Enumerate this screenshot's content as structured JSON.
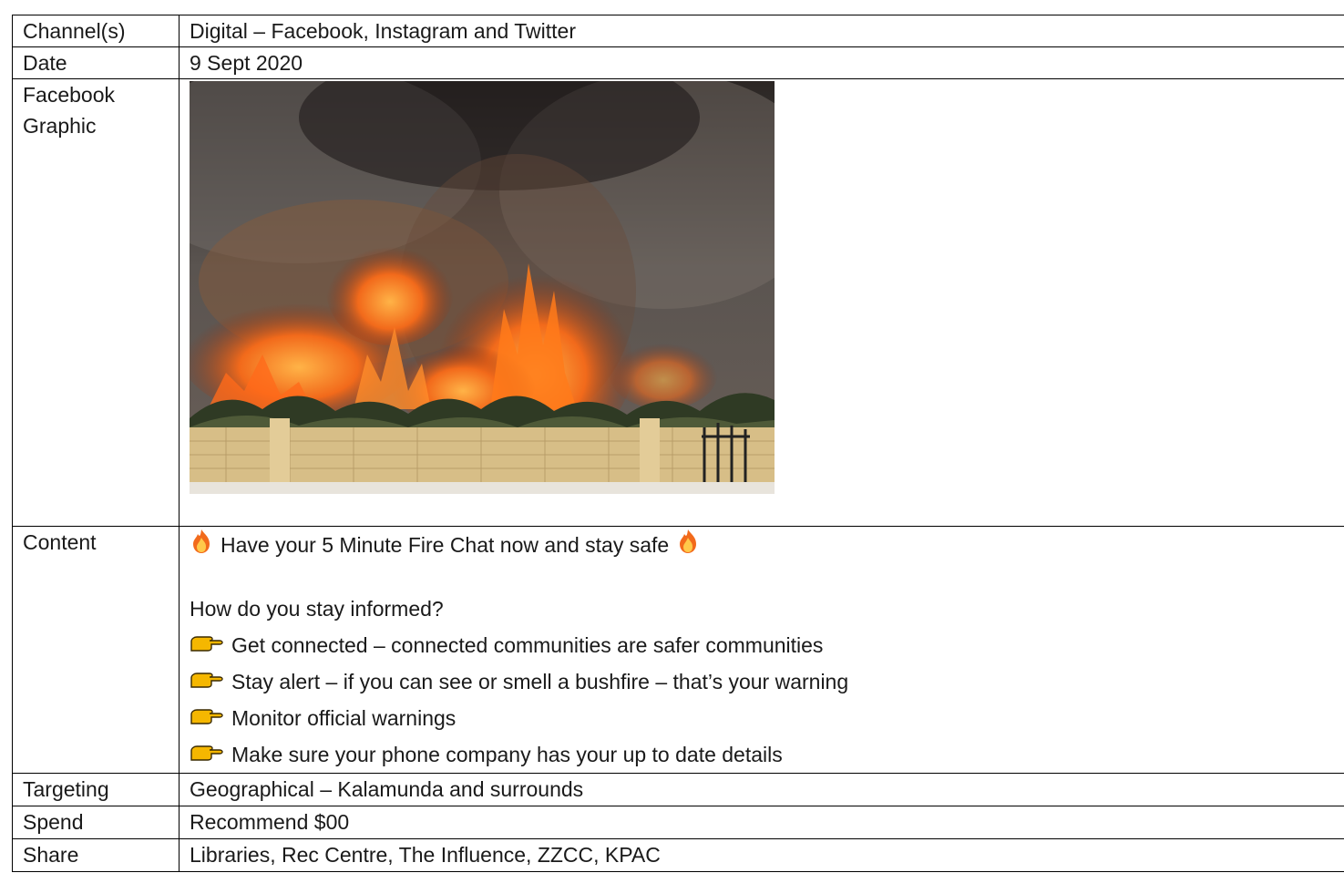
{
  "rows": {
    "channel": {
      "label": "Channel(s)",
      "value": "Digital – Facebook, Instagram and Twitter"
    },
    "date": {
      "label": "Date",
      "value": "9 Sept 2020"
    },
    "graphic": {
      "label_line1": "Facebook",
      "label_line2": "Graphic"
    },
    "content": {
      "label": "Content",
      "headline": "Have your 5 Minute Fire Chat now and stay safe",
      "question": "How do you stay informed?",
      "points": [
        "Get connected – connected communities are safer communities",
        "Stay alert – if you can see or smell a bushfire – that’s your warning",
        "Monitor official warnings",
        "Make sure your phone company has your up to date details"
      ]
    },
    "targeting": {
      "label": "Targeting",
      "value": "Geographical – Kalamunda and surrounds"
    },
    "spend": {
      "label": "Spend",
      "value": "Recommend $00"
    },
    "share": {
      "label": "Share",
      "value": "Libraries, Rec Centre, The Influence, ZZCC, KPAC"
    }
  },
  "icons": {
    "headline": "fire-emoji-icon",
    "points": "backhand-index-pointing-right-emoji-icon"
  },
  "colors": {
    "border": "#000000",
    "text": "#1a1a1a",
    "fire": "#f26a1b",
    "hand": "#f5b700"
  }
}
